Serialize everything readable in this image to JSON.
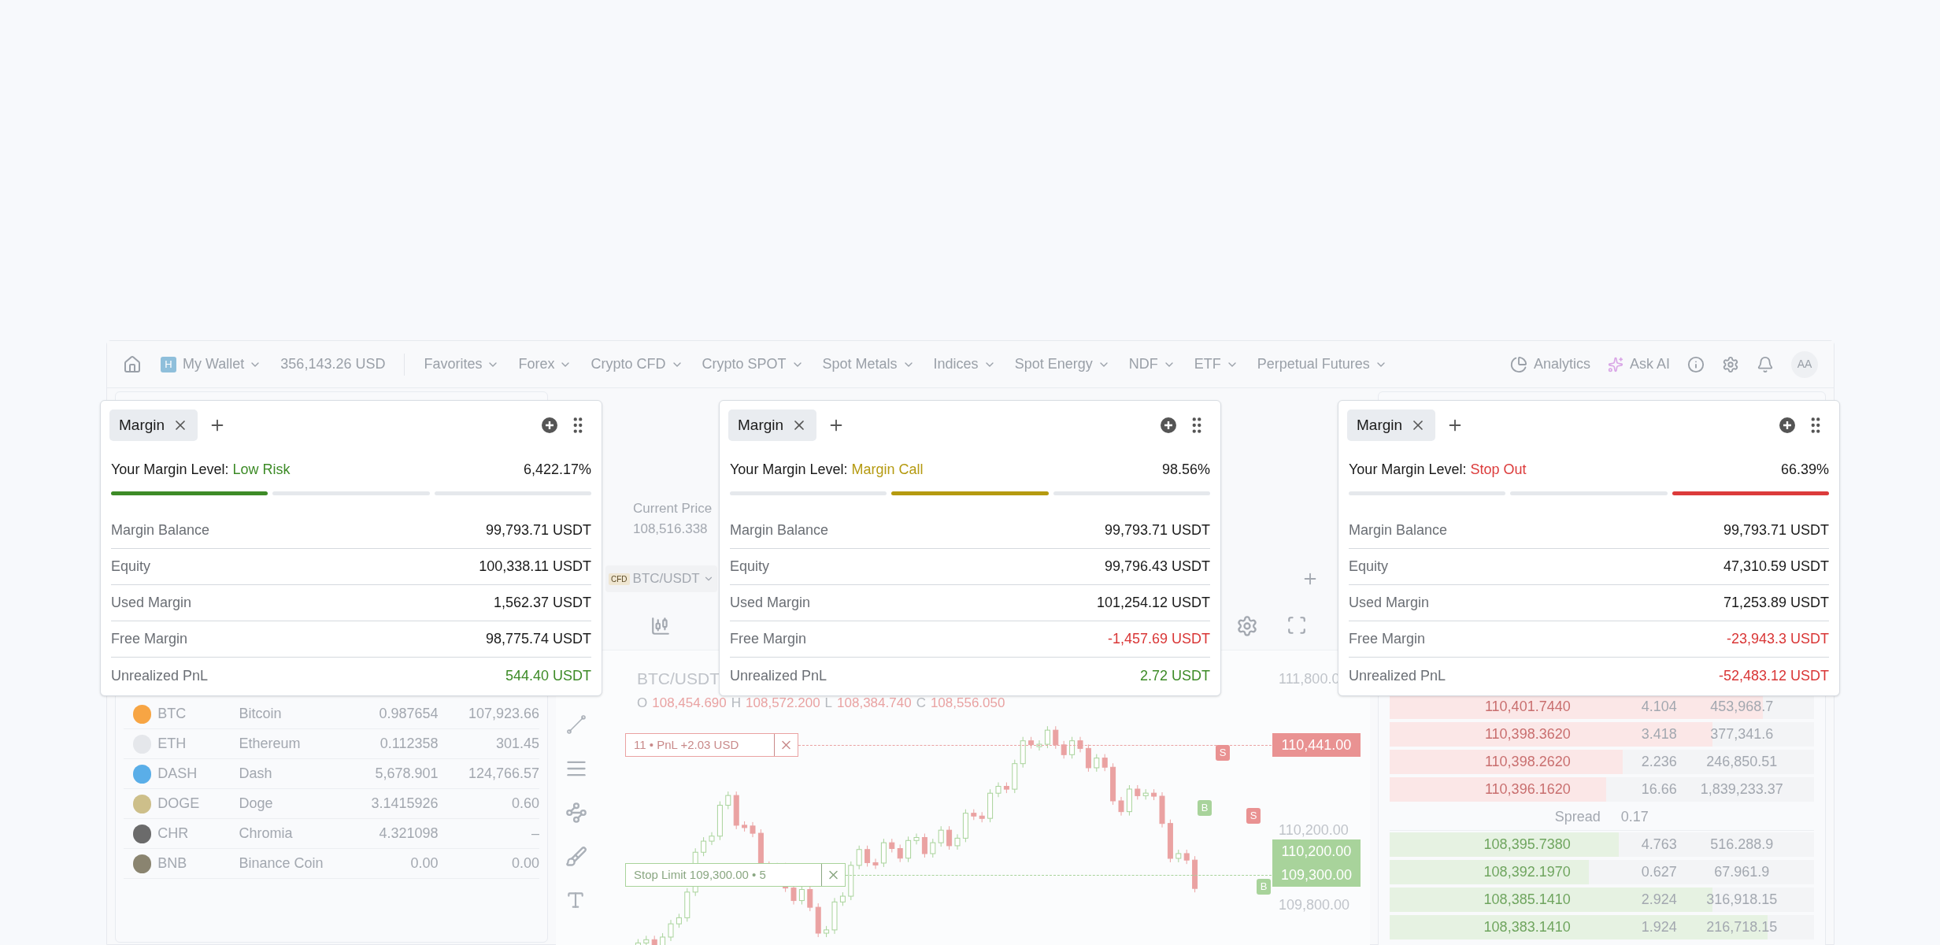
{
  "nav": {
    "wallet_badge": "H",
    "wallet": "My Wallet",
    "balance": "356,143.26 USD",
    "menus": [
      "Favorites",
      "Forex",
      "Crypto CFD",
      "Crypto SPOT",
      "Spot Metals",
      "Indices",
      "Spot Energy",
      "NDF",
      "ETF",
      "Perpetual Futures"
    ],
    "analytics": "Analytics",
    "ask_ai": "Ask AI",
    "avatar": "AA"
  },
  "assets": [
    {
      "symbol": "BTC",
      "name": "Bitcoin",
      "amount": "0.987654",
      "value": "107,923.66",
      "color": "#f7a544"
    },
    {
      "symbol": "ETH",
      "name": "Ethereum",
      "amount": "0.112358",
      "value": "301.45",
      "color": "#e5e7eb"
    },
    {
      "symbol": "DASH",
      "name": "Dash",
      "amount": "5,678.901",
      "value": "124,766.57",
      "color": "#5aaee8"
    },
    {
      "symbol": "DOGE",
      "name": "Doge",
      "amount": "3.1415926",
      "value": "0.60",
      "color": "#cdbf8a"
    },
    {
      "symbol": "CHR",
      "name": "Chromia",
      "amount": "4.321098",
      "value": "–",
      "color": "#6b6b6b"
    },
    {
      "symbol": "BNB",
      "name": "Binance Coin",
      "amount": "0.00",
      "value": "0.00",
      "color": "#8a8470"
    }
  ],
  "chart_panel": {
    "current_price_label": "Current Price",
    "current_price": "108,516.338",
    "pair_badge": "CFD",
    "pair": "BTC/USDT",
    "title": "BTC/USDT",
    "ohlc": [
      {
        "key": "O",
        "value": "108,454.690"
      },
      {
        "key": "H",
        "value": "108,572.200"
      },
      {
        "key": "L",
        "value": "108,384.740"
      },
      {
        "key": "C",
        "value": "108,556.050"
      }
    ],
    "price_labels": [
      "111,800.0",
      "110,200.00",
      "109,800.00"
    ],
    "price_tags": [
      {
        "text": "110,441.00",
        "kind": "sell"
      },
      {
        "text": "110,200.00",
        "kind": "buy"
      },
      {
        "text": "109,300.00",
        "kind": "buy"
      }
    ],
    "orders": [
      {
        "text": "11 • PnL +2.03 USD",
        "kind": "sell"
      },
      {
        "text": "Stop Limit 109,300.00 • 5",
        "kind": "buy"
      }
    ],
    "markers": [
      {
        "text": "S",
        "kind": "sell"
      },
      {
        "text": "B",
        "kind": "buy"
      },
      {
        "text": "S",
        "kind": "sell"
      },
      {
        "text": "B",
        "kind": "buy"
      }
    ]
  },
  "order_book": {
    "asks": [
      {
        "price": "110,401.7440",
        "amount": "4.104",
        "total": "453,968.7",
        "level": 0.88
      },
      {
        "price": "110,398.3620",
        "amount": "3.418",
        "total": "377,341.6",
        "level": 0.76
      },
      {
        "price": "110,398.2620",
        "amount": "2.236",
        "total": "246,850.51",
        "level": 0.55
      },
      {
        "price": "110,396.1620",
        "amount": "16.66",
        "total": "1,839,233.37",
        "level": 0.51
      }
    ],
    "spread": {
      "label": "Spread",
      "value": "0.17"
    },
    "bids": [
      {
        "price": "108,395.7380",
        "amount": "4.763",
        "total": "516.288.9",
        "level": 0.54
      },
      {
        "price": "108,392.1970",
        "amount": "0.627",
        "total": "67.961.9",
        "level": 0.47
      },
      {
        "price": "108,385.1410",
        "amount": "2.924",
        "total": "316,918.15",
        "level": 0.76
      },
      {
        "price": "108,383.1410",
        "amount": "1.924",
        "total": "216,718.15",
        "level": 0.89
      }
    ]
  },
  "cards": [
    {
      "tab": "Margin",
      "level_label": "Your Margin Level:",
      "status": "Low Risk",
      "color": "#3d8b27",
      "percent": "6,422.17%",
      "segments": [
        {
          "selected": true
        },
        {
          "selected": false
        },
        {
          "selected": false
        }
      ],
      "rows": [
        {
          "label": "Margin Balance",
          "value": "99,793.71 USDT",
          "kind": "plain"
        },
        {
          "label": "Equity",
          "value": "100,338.11 USDT",
          "kind": "plain"
        },
        {
          "label": "Used Margin",
          "value": "1,562.37 USDT",
          "kind": "plain"
        },
        {
          "label": "Free Margin",
          "value": "98,775.74 USDT",
          "kind": "plain"
        },
        {
          "label": "Unrealized PnL",
          "value": "544.40 USDT",
          "kind": "positive"
        }
      ]
    },
    {
      "tab": "Margin",
      "level_label": "Your Margin Level:",
      "status": "Margin Call",
      "color": "#b59a10",
      "percent": "98.56%",
      "segments": [
        {
          "selected": false
        },
        {
          "selected": true
        },
        {
          "selected": false
        }
      ],
      "rows": [
        {
          "label": "Margin Balance",
          "value": "99,793.71 USDT",
          "kind": "plain"
        },
        {
          "label": "Equity",
          "value": "99,796.43 USDT",
          "kind": "plain"
        },
        {
          "label": "Used Margin",
          "value": "101,254.12 USDT",
          "kind": "plain"
        },
        {
          "label": "Free Margin",
          "value": "-1,457.69 USDT",
          "kind": "negative"
        },
        {
          "label": "Unrealized PnL",
          "value": "2.72 USDT",
          "kind": "positive"
        }
      ]
    },
    {
      "tab": "Margin",
      "level_label": "Your Margin Level:",
      "status": "Stop Out",
      "color": "#dc3b3b",
      "percent": "66.39%",
      "segments": [
        {
          "selected": false
        },
        {
          "selected": false
        },
        {
          "selected": true
        }
      ],
      "rows": [
        {
          "label": "Margin Balance",
          "value": "99,793.71 USDT",
          "kind": "plain"
        },
        {
          "label": "Equity",
          "value": "47,310.59 USDT",
          "kind": "plain"
        },
        {
          "label": "Used Margin",
          "value": "71,253.89 USDT",
          "kind": "plain"
        },
        {
          "label": "Free Margin",
          "value": "-23,943.3 USDT",
          "kind": "negative"
        },
        {
          "label": "Unrealized PnL",
          "value": "-52,483.12 USDT",
          "kind": "negative"
        }
      ]
    }
  ]
}
